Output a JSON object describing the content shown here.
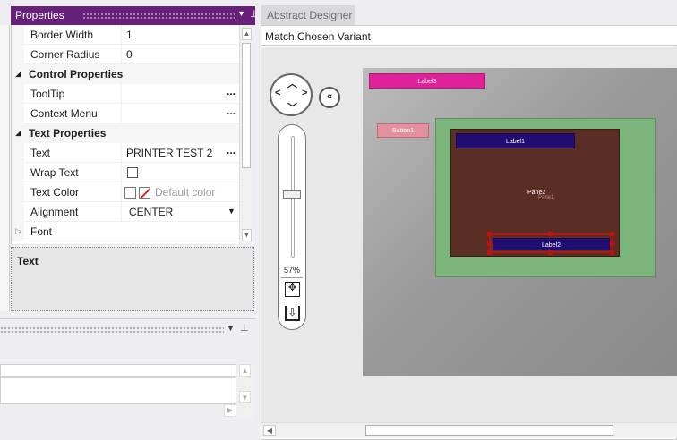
{
  "properties_panel": {
    "title": "Properties",
    "rows": [
      {
        "kind": "prop",
        "label": "Border Width",
        "value": "1"
      },
      {
        "kind": "prop",
        "label": "Corner Radius",
        "value": "0"
      },
      {
        "kind": "category",
        "label": "Control Properties"
      },
      {
        "kind": "prop",
        "label": "ToolTip",
        "value": "",
        "ellipsis": "..."
      },
      {
        "kind": "prop",
        "label": "Context Menu",
        "value": "",
        "ellipsis": "..."
      },
      {
        "kind": "category",
        "label": "Text Properties"
      },
      {
        "kind": "prop",
        "label": "Text",
        "value": "PRINTER TEST 2",
        "ellipsis": "..."
      },
      {
        "kind": "prop",
        "label": "Wrap Text",
        "value": "",
        "checked": false
      },
      {
        "kind": "prop",
        "label": "Text Color",
        "value": "Default color"
      },
      {
        "kind": "prop",
        "label": "Alignment",
        "value": "CENTER"
      },
      {
        "kind": "collapsed",
        "label": "Font"
      }
    ],
    "description_title": "Text"
  },
  "designer": {
    "tab_label": "Abstract Designer",
    "variant_label": "Match Chosen Variant",
    "zoom_level": "57%",
    "zoom_fraction": 0.57,
    "controls": {
      "label3": "Label3",
      "button1": "Button1",
      "label1": "Label1",
      "pane2": "Pane2",
      "pane1": "Pane1",
      "label2": "Label2"
    },
    "colors": {
      "label3_bg": "#e0229a",
      "button1_bg": "#e2919c",
      "panel_green": "#7bb57b",
      "pane2_bg": "#5b2e25",
      "label_blue": "#220e72",
      "selection": "#c01010"
    }
  },
  "icons": {
    "panel_dropdown": "chevron-down-icon",
    "panel_pin": "pin-icon",
    "nav": "pan-arrows-icon",
    "collapse": "double-chevron-left-icon",
    "fit": "fit-to-screen-icon",
    "export": "export-icon"
  },
  "theme": {
    "accent": "#68217a"
  }
}
